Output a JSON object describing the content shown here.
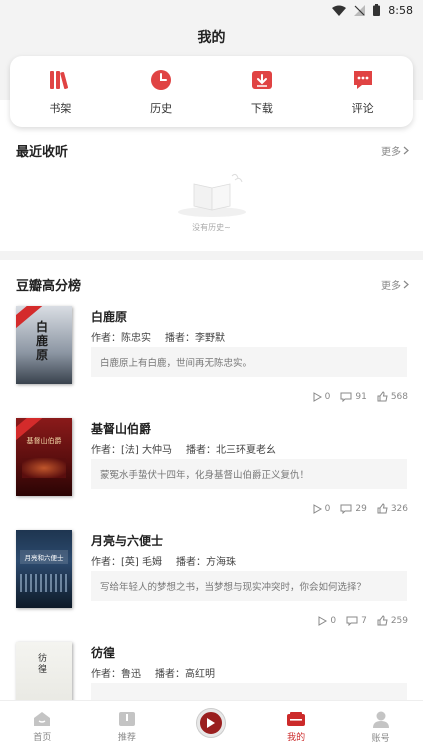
{
  "status_bar": {
    "time": "8:58"
  },
  "header": {
    "title": "我的"
  },
  "quick_actions": [
    {
      "label": "书架",
      "icon": "bookshelf-icon"
    },
    {
      "label": "历史",
      "icon": "clock-icon"
    },
    {
      "label": "下载",
      "icon": "download-icon"
    },
    {
      "label": "评论",
      "icon": "comment-icon"
    }
  ],
  "recent": {
    "title": "最近收听",
    "more": "更多",
    "empty_text": "没有历史~"
  },
  "ranking": {
    "title": "豆瓣高分榜",
    "more": "更多",
    "books": [
      {
        "title": "白鹿原",
        "author": "作者：陈忠实",
        "narrator": "播者：李野默",
        "desc": "白鹿原上有白鹿，世间再无陈忠实。",
        "plays": "0",
        "comments": "91",
        "likes": "568",
        "cover_title": "白鹿原"
      },
      {
        "title": "基督山伯爵",
        "author": "作者：[法] 大仲马",
        "narrator": "播者：北三环夏老幺",
        "desc": "蒙冤水手蛰伏十四年，化身基督山伯爵正义复仇！",
        "plays": "0",
        "comments": "29",
        "likes": "326",
        "cover_title": "基督山伯爵"
      },
      {
        "title": "月亮与六便士",
        "author": "作者：[英] 毛姆",
        "narrator": "播者：方海珠",
        "desc": "写给年轻人的梦想之书，当梦想与现实冲突时，你会如何选择？",
        "plays": "0",
        "comments": "7",
        "likes": "259",
        "cover_title": "月亮和六便士"
      },
      {
        "title": "彷徨",
        "author": "作者：鲁迅",
        "narrator": "播者：高红明",
        "desc": "",
        "plays": "",
        "comments": "",
        "likes": "",
        "cover_title": "彷徨"
      }
    ]
  },
  "tabbar": [
    {
      "label": "首页",
      "icon": "home-icon"
    },
    {
      "label": "推荐",
      "icon": "book-icon"
    },
    {
      "label": "",
      "icon": "play-icon"
    },
    {
      "label": "我的",
      "icon": "mine-icon"
    },
    {
      "label": "账号",
      "icon": "account-icon"
    }
  ],
  "colors": {
    "accent": "#cc2a2a",
    "header_bg": "#f3f3f3"
  }
}
